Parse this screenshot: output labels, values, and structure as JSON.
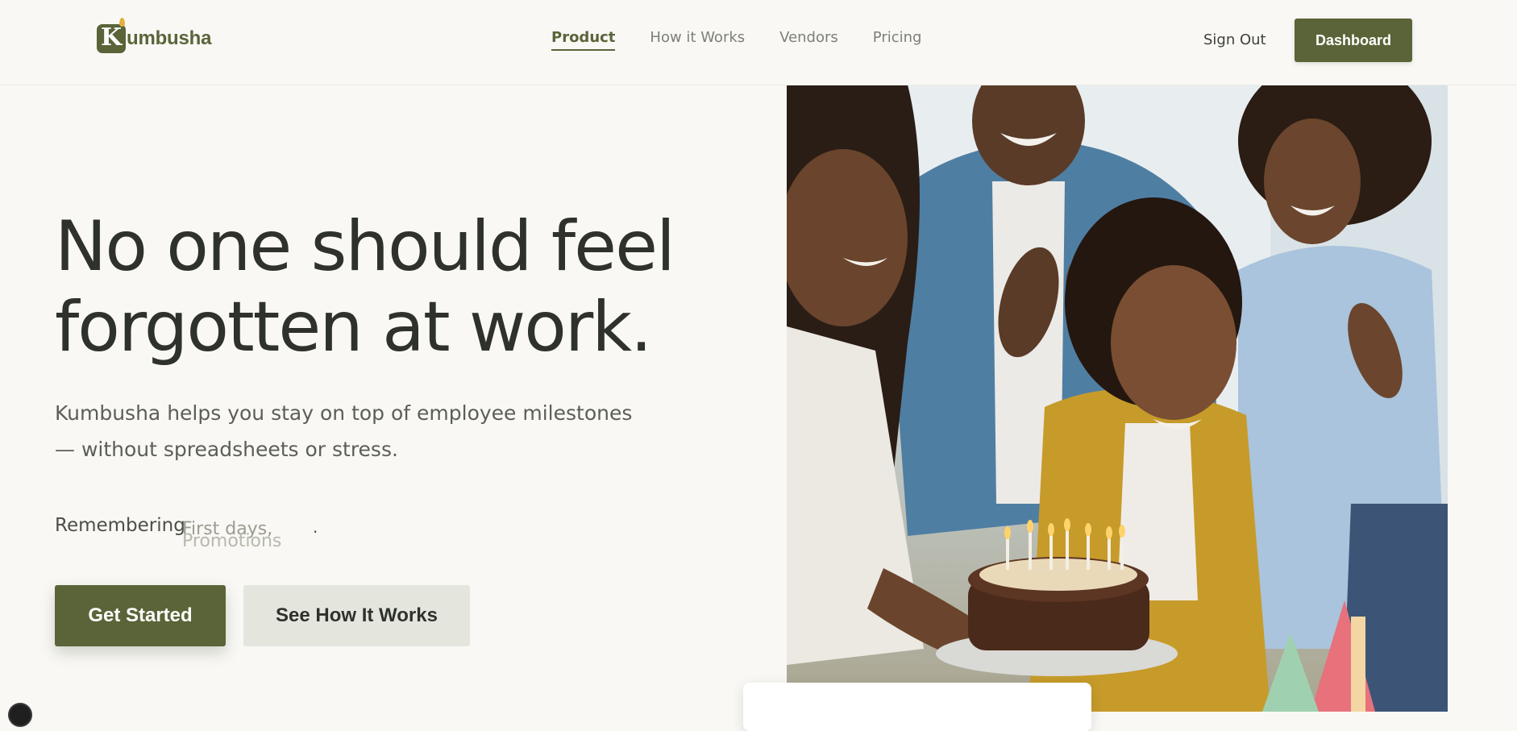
{
  "nav": {
    "logo_letter": "K",
    "logo_text": "umbusha",
    "links": [
      {
        "label": "Product",
        "active": true
      },
      {
        "label": "How it Works",
        "active": false
      },
      {
        "label": "Vendors",
        "active": false
      },
      {
        "label": "Pricing",
        "active": false
      }
    ],
    "sign_out": "Sign Out",
    "dashboard": "Dashboard"
  },
  "hero": {
    "headline_line1": "No one should feel",
    "headline_line2": "forgotten at work.",
    "subtext": "Kumbusha helps you stay on top of employee milestones — without spreadsheets or stress.",
    "remembering_label": "Remembering",
    "rotating_words": [
      "First days,",
      "Promotions"
    ],
    "trailing_dot": ".",
    "primary_cta": "Get Started",
    "secondary_cta": "See How It Works"
  },
  "colors": {
    "brand": "#5a6438",
    "background": "#f9f8f5",
    "secondary_button": "#e4e6de",
    "text_dark": "#2f312c",
    "logo_flame": "#e3b03a"
  },
  "icons": {
    "logo": "kumbusha-logo-icon",
    "scroll_button": "circle-button-icon"
  }
}
